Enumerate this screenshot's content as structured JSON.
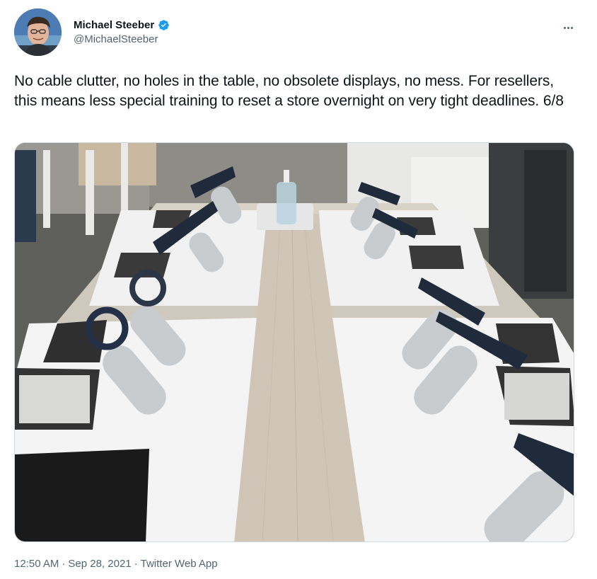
{
  "author": {
    "display_name": "Michael Steeber",
    "handle": "@MichaelSteeber",
    "verified": true
  },
  "tweet": {
    "text": "No cable clutter, no holes in the table, no obsolete displays, no mess. For resellers, this means less special training to reset a store overnight on very tight deadlines. 6/8"
  },
  "meta": {
    "time": "12:50 AM",
    "separator": "·",
    "date": "Sep 28, 2021",
    "source": "Twitter Web App"
  },
  "icons": {
    "verified": "verified-badge-icon",
    "more": "more-options-icon"
  },
  "colors": {
    "text_primary": "#0f1419",
    "text_secondary": "#536471",
    "verified_blue": "#1d9bf0",
    "border": "#cfd9de"
  }
}
